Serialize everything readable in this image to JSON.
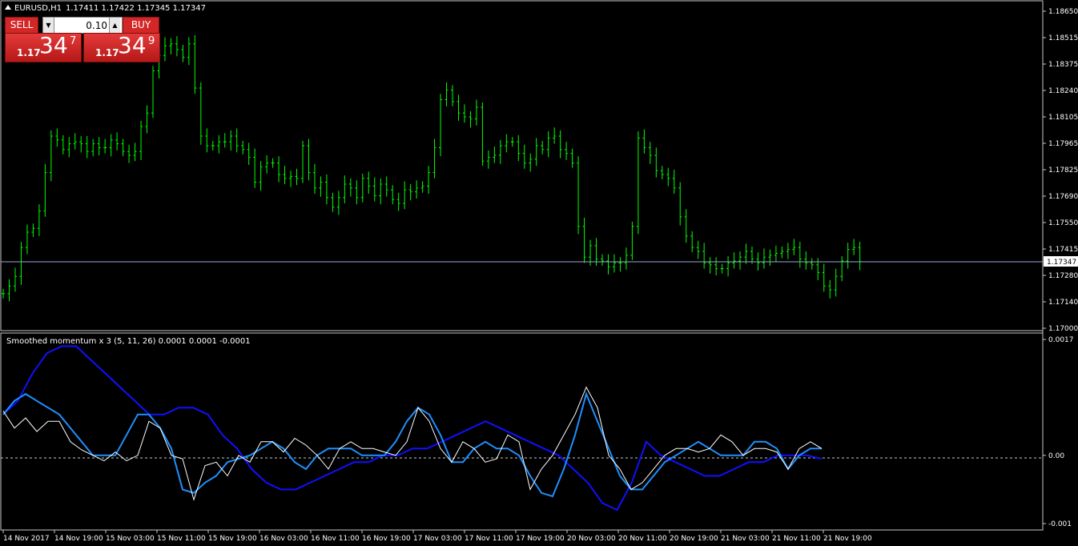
{
  "symbol_header": {
    "symbol": "EURUSD,H1",
    "ohlc": "1.17411 1.17422 1.17345 1.17347"
  },
  "trade_panel": {
    "sell_label": "SELL",
    "buy_label": "BUY",
    "lot_value": "0.10",
    "sell_price": {
      "prefix": "1.17",
      "big": "34",
      "pip": "7"
    },
    "buy_price": {
      "prefix": "1.17",
      "big": "34",
      "pip": "9"
    }
  },
  "price_axis": {
    "ticks": [
      "1.18650",
      "1.18515",
      "1.18375",
      "1.18240",
      "1.18105",
      "1.17965",
      "1.17825",
      "1.17690",
      "1.17550",
      "1.17415",
      "1.17280",
      "1.17140",
      "1.17000"
    ],
    "current_price": "1.17347"
  },
  "indicator": {
    "label": "Smoothed momentum x 3 (5, 11, 26) 0.0001 0.0001 -0.0001",
    "ticks": [
      "0.0017",
      "0.00",
      "-0.001"
    ]
  },
  "time_axis": {
    "labels": [
      "14 Nov 2017",
      "14 Nov 19:00",
      "15 Nov 03:00",
      "15 Nov 11:00",
      "15 Nov 19:00",
      "16 Nov 03:00",
      "16 Nov 11:00",
      "16 Nov 19:00",
      "17 Nov 03:00",
      "17 Nov 11:00",
      "17 Nov 19:00",
      "20 Nov 03:00",
      "20 Nov 11:00",
      "20 Nov 19:00",
      "21 Nov 03:00",
      "21 Nov 11:00",
      "21 Nov 19:00"
    ]
  },
  "colors": {
    "bars": "#00ff00",
    "current_line": "#9aa7d6",
    "fast": "#ffffff",
    "mid": "#1e90ff",
    "slow": "#1010ff"
  },
  "chart_data": [
    {
      "type": "ohlc",
      "title": "EURUSD,H1",
      "ylim": [
        1.17,
        1.1865
      ],
      "timeframe": "H1",
      "approx_closes": [
        1.1718,
        1.1722,
        1.1727,
        1.1742,
        1.175,
        1.1752,
        1.1761,
        1.1781,
        1.18,
        1.1798,
        1.1793,
        1.1796,
        1.1797,
        1.1796,
        1.1792,
        1.1796,
        1.1794,
        1.1794,
        1.1798,
        1.1796,
        1.1792,
        1.179,
        1.1792,
        1.1805,
        1.1812,
        1.1834,
        1.1842,
        1.1847,
        1.1848,
        1.1845,
        1.1841,
        1.1848,
        1.1825,
        1.18,
        1.1795,
        1.1795,
        1.1797,
        1.1797,
        1.18,
        1.1795,
        1.1793,
        1.1789,
        1.1776,
        1.1784,
        1.1786,
        1.1786,
        1.178,
        1.1778,
        1.1779,
        1.1778,
        1.1795,
        1.1781,
        1.1773,
        1.1776,
        1.1768,
        1.1763,
        1.1768,
        1.1775,
        1.1773,
        1.1768,
        1.1778,
        1.1774,
        1.1769,
        1.1775,
        1.1772,
        1.1767,
        1.1765,
        1.1772,
        1.1771,
        1.1773,
        1.1774,
        1.1781,
        1.1794,
        1.1819,
        1.1824,
        1.1818,
        1.1812,
        1.181,
        1.1809,
        1.1815,
        1.1787,
        1.1789,
        1.179,
        1.1795,
        1.1797,
        1.1797,
        1.1791,
        1.1786,
        1.1788,
        1.1795,
        1.1793,
        1.1799,
        1.18,
        1.1793,
        1.1791,
        1.1786,
        1.1753,
        1.1737,
        1.1743,
        1.1736,
        1.1735,
        1.1732,
        1.1734,
        1.1734,
        1.1738,
        1.1753,
        1.1799,
        1.1794,
        1.179,
        1.1782,
        1.178,
        1.1778,
        1.1773,
        1.1758,
        1.1748,
        1.1742,
        1.174,
        1.1734,
        1.1733,
        1.1731,
        1.1731,
        1.1734,
        1.1735,
        1.1737,
        1.174,
        1.1736,
        1.1734,
        1.1737,
        1.1738,
        1.1739,
        1.174,
        1.1741,
        1.1742,
        1.1736,
        1.1734,
        1.1733,
        1.1729,
        1.1722,
        1.172,
        1.1727,
        1.1735,
        1.1741,
        1.1742,
        1.17347
      ]
    },
    {
      "type": "line",
      "title": "Smoothed momentum x 3 (5, 11, 26) 0.0001 0.0001 -0.0001",
      "ylim": [
        -0.001,
        0.0017
      ],
      "zero_line": 0.0,
      "series": [
        {
          "values": [
            0.00065,
            0.0004,
            0.00055,
            0.00035,
            0.0005,
            0.0005,
            0.0002,
            8e-05,
            0.0,
            -8e-05,
            5e-05,
            -8e-05,
            0.0,
            0.0005,
            0.0004,
            0.0,
            -5e-05,
            -0.00065,
            -0.00015,
            -0.0001,
            -0.0003,
            0.0,
            -0.0001,
            0.0002,
            0.0002,
            5e-05,
            0.00025,
            0.00015,
            0.0,
            -0.0002,
            0.0001,
            0.0002,
            0.0001,
            0.0001,
            5e-05,
            0.0,
            0.0002,
            0.0007,
            0.0005,
            0.0001,
            -0.0001,
            0.0002,
            0.0001,
            -0.0001,
            -5e-05,
            0.0003,
            0.0002,
            -0.0005,
            -0.0002,
            0.0,
            0.0003,
            0.0006,
            0.001,
            0.0007,
            0.0,
            -0.0002,
            -0.0005,
            -0.0004,
            -0.0002,
            0.0,
            0.0001,
            0.0001,
            5e-05,
            0.0001,
            0.0003,
            0.0002,
            0.0,
            0.0001,
            0.0001,
            5e-05,
            -0.0002,
            0.0001,
            0.0002,
            0.0001
          ]
        },
        {
          "values": [
            0.0006,
            0.0008,
            0.0009,
            0.0008,
            0.0007,
            0.0006,
            0.0004,
            0.0002,
            0.0,
            0.0,
            0.0,
            0.0003,
            0.0006,
            0.0006,
            0.0004,
            0.0001,
            -0.0005,
            -0.00055,
            -0.0004,
            -0.0003,
            -0.0001,
            -5e-05,
            0.0,
            0.0001,
            0.0002,
            0.0001,
            -0.0001,
            -0.0002,
            0.0,
            0.0001,
            0.0001,
            0.0001,
            0.0,
            0.0,
            0.0,
            0.0002,
            0.0005,
            0.0007,
            0.0006,
            0.0003,
            -0.0001,
            -0.0001,
            0.0001,
            0.0002,
            0.0001,
            0.0001,
            0.0,
            -0.0003,
            -0.00055,
            -0.0006,
            -0.0002,
            0.0003,
            0.0009,
            0.0005,
            0.0001,
            -0.0003,
            -0.0005,
            -0.0005,
            -0.0003,
            -0.0001,
            0.0,
            0.0001,
            0.0002,
            0.0001,
            0.0,
            0.0,
            0.0,
            0.0002,
            0.0002,
            0.0001,
            -0.0002,
            0.0,
            0.0001,
            0.0001
          ]
        },
        {
          "values": [
            0.0006,
            0.0008,
            0.0012,
            0.0015,
            0.0016,
            0.0016,
            0.0014,
            0.0012,
            0.001,
            0.0008,
            0.0006,
            0.0006,
            0.0007,
            0.0007,
            0.0006,
            0.0003,
            0.0001,
            -0.0002,
            -0.0004,
            -0.0005,
            -0.0005,
            -0.0004,
            -0.0003,
            -0.0002,
            -0.0001,
            -0.0001,
            0.0,
            0.0,
            0.0001,
            0.0001,
            0.0002,
            0.0003,
            0.0004,
            0.0005,
            0.0004,
            0.0003,
            0.0002,
            0.0001,
            0.0,
            -0.0002,
            -0.0004,
            -0.0007,
            -0.0008,
            -0.0004,
            0.0002,
            0.0,
            -0.0001,
            -0.0002,
            -0.0003,
            -0.0003,
            -0.0002,
            -0.0001,
            -0.0001,
            0.0,
            0.0,
            0.0,
            -5e-05
          ]
        }
      ]
    }
  ]
}
